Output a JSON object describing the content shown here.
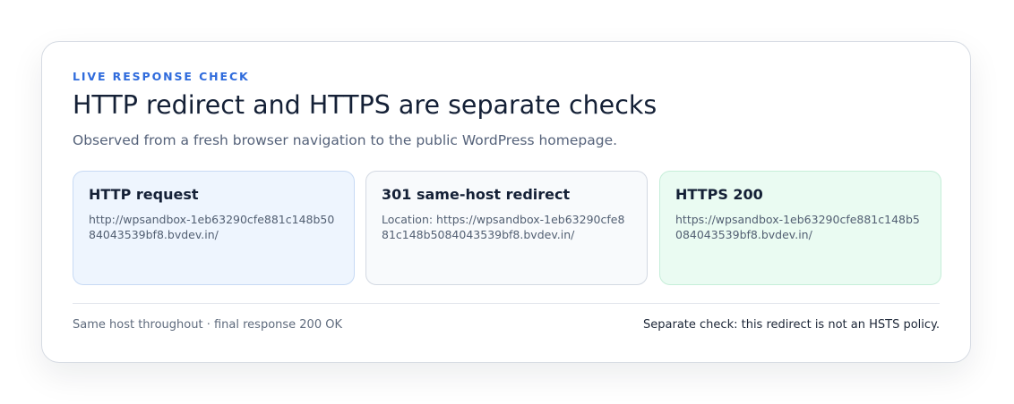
{
  "header": {
    "eyebrow": "LIVE RESPONSE CHECK",
    "title": "HTTP redirect and HTTPS are separate checks",
    "subtitle": "Observed from a fresh browser navigation to the public WordPress homepage."
  },
  "steps": [
    {
      "title": "HTTP request",
      "body": "http://wpsandbox-1eb63290cfe881c148b5084043539bf8.bvdev.in/"
    },
    {
      "title": "301 same-host redirect",
      "body": "Location: https://wpsandbox-1eb63290cfe881c148b5084043539bf8.bvdev.in/"
    },
    {
      "title": "HTTPS 200",
      "body": "https://wpsandbox-1eb63290cfe881c148b5084043539bf8.bvdev.in/"
    }
  ],
  "footer": {
    "left": "Same host throughout · final response 200 OK",
    "right": "Separate check: this redirect is not an HSTS policy."
  },
  "colors": {
    "accent": "#2f6bdc",
    "request_tile": "#eef5fe",
    "redirect_tile": "#f8fafc",
    "success_tile": "#eafbf2"
  }
}
